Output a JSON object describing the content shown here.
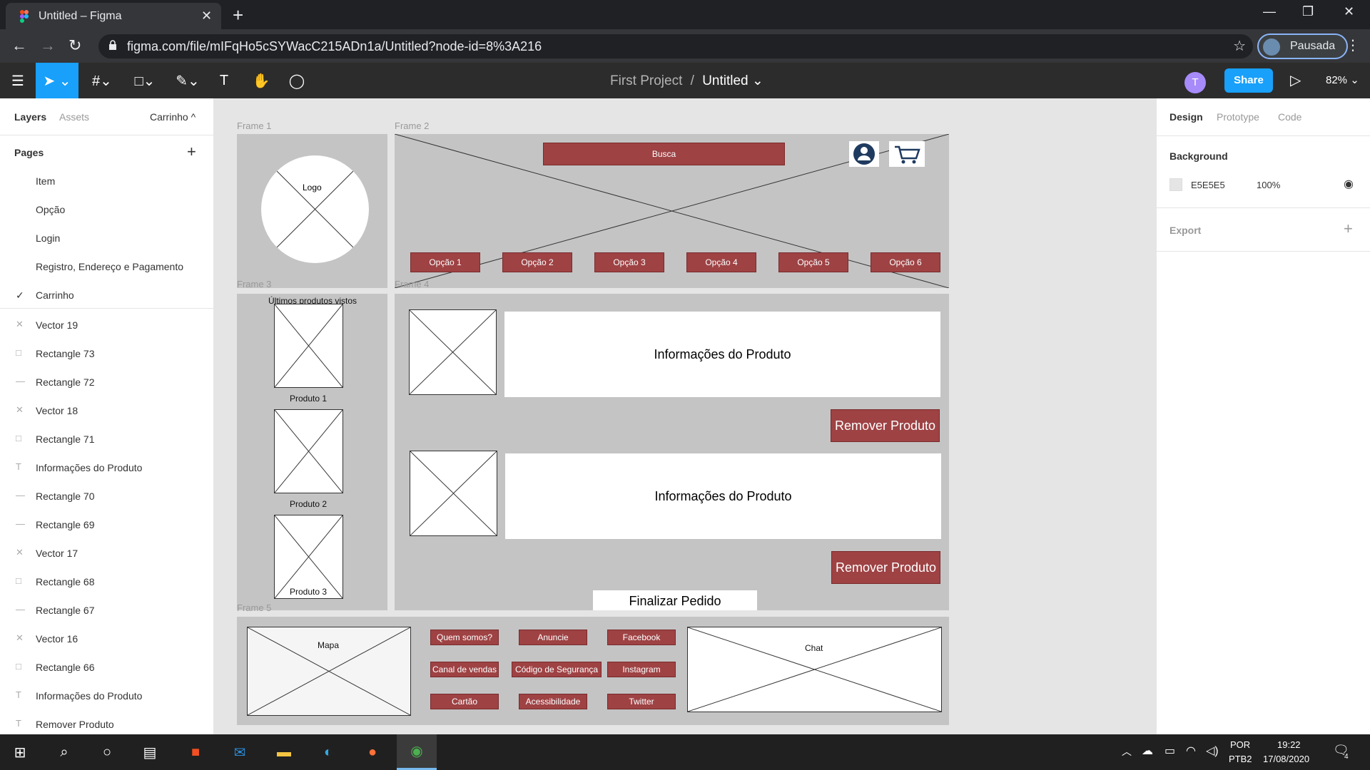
{
  "browser": {
    "tab_title": "Untitled – Figma",
    "tab_close": "✕",
    "new_tab": "+",
    "url": "figma.com/file/mIFqHo5cSYWacC215ADn1a/Untitled?node-id=8%3A216",
    "profile_label": "Pausada",
    "window_buttons": [
      "—",
      "❐",
      "✕"
    ]
  },
  "figma_toolbar": {
    "project": "First Project",
    "separator": "/",
    "file_name": "Untitled ⌄",
    "user_initial": "T",
    "share_label": "Share",
    "zoom": "82% ⌄",
    "icons": [
      "menu-icon",
      "move-icon",
      "frame-icon",
      "shape-icon",
      "pen-icon",
      "text-icon",
      "hand-icon",
      "comment-icon"
    ]
  },
  "left_panel": {
    "tab_layers": "Layers",
    "tab_assets": "Assets",
    "current_page": "Carrinho ^",
    "pages_title": "Pages",
    "add": "+",
    "pages": [
      "Item",
      "Opção",
      "Login",
      "Registro, Endereço e Pagamento",
      "Carrinho"
    ],
    "active_page_check": "✓",
    "layers": [
      {
        "type": "vector",
        "name": "Vector 19"
      },
      {
        "type": "rect",
        "name": "Rectangle 73"
      },
      {
        "type": "line",
        "name": "Rectangle 72"
      },
      {
        "type": "vector",
        "name": "Vector 18"
      },
      {
        "type": "rect",
        "name": "Rectangle 71"
      },
      {
        "type": "text",
        "name": "Informações do Produto"
      },
      {
        "type": "line",
        "name": "Rectangle 70"
      },
      {
        "type": "line",
        "name": "Rectangle 69"
      },
      {
        "type": "vector",
        "name": "Vector 17"
      },
      {
        "type": "rect",
        "name": "Rectangle 68"
      },
      {
        "type": "line",
        "name": "Rectangle 67"
      },
      {
        "type": "vector",
        "name": "Vector 16"
      },
      {
        "type": "rect",
        "name": "Rectangle 66"
      },
      {
        "type": "text",
        "name": "Informações do Produto"
      },
      {
        "type": "text",
        "name": "Remover Produto"
      }
    ]
  },
  "right_panel": {
    "tab_design": "Design",
    "tab_prototype": "Prototype",
    "tab_code": "Code",
    "background_title": "Background",
    "bg_hex": "E5E5E5",
    "bg_opacity": "100%",
    "export_title": "Export",
    "export_add": "+",
    "bg_color": "#e5e5e5"
  },
  "canvas": {
    "frame1_label": "Frame 1",
    "frame2_label": "Frame 2",
    "frame3_label": "Frame 3",
    "frame4_label": "Frame 4",
    "frame5_label": "Frame 5",
    "logo": "Logo",
    "busca": "Busca",
    "options": [
      "Opção 1",
      "Opção 2",
      "Opção 3",
      "Opção 4",
      "Opção 5",
      "Opção 6"
    ],
    "recent_title": "Últimos produtos vistos",
    "products": [
      "Produto 1",
      "Produto 2",
      "Produto 3"
    ],
    "product_info": "Informações do Produto",
    "remove_product": "Remover Produto",
    "finalize": "Finalizar Pedido",
    "map": "Mapa",
    "chat": "Chat",
    "footer_links": [
      "Quem somos?",
      "Anuncie",
      "Facebook",
      "Canal de vendas",
      "Código de Segurança",
      "Instagram",
      "Cartão",
      "Acessibilidade",
      "Twitter"
    ],
    "accent_color": "#9e4244"
  },
  "help": "?",
  "taskbar": {
    "lang_top": "POR",
    "lang_bottom": "PTB2",
    "time": "19:22",
    "date": "17/08/2020",
    "notif_count": "4"
  }
}
